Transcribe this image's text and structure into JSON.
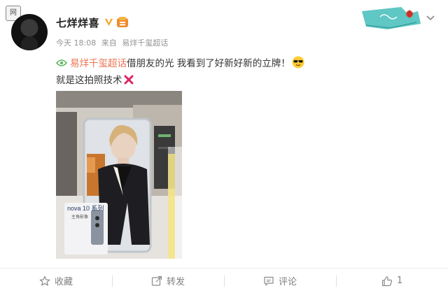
{
  "corner_badge": "网",
  "user": {
    "name": "七烊烊喜"
  },
  "meta": {
    "time": "今天 18:08",
    "source_prefix": "来自",
    "source": "易烊千玺超话"
  },
  "post": {
    "topic": "易烊千玺超话",
    "text_line1": "借朋友的光 我看到了好新好新的立牌！",
    "text_line2": "就是这拍照技术"
  },
  "photo": {
    "standee_text_brand": "nova 10 系列",
    "standee_text_sub": "主角影像"
  },
  "actions": {
    "favorite": "收藏",
    "repost": "转发",
    "comment": "评论",
    "like_count": "1"
  },
  "colors": {
    "topic": "#eb7350",
    "vip": "#f5a623",
    "text": "#333333",
    "meta": "#939393"
  }
}
